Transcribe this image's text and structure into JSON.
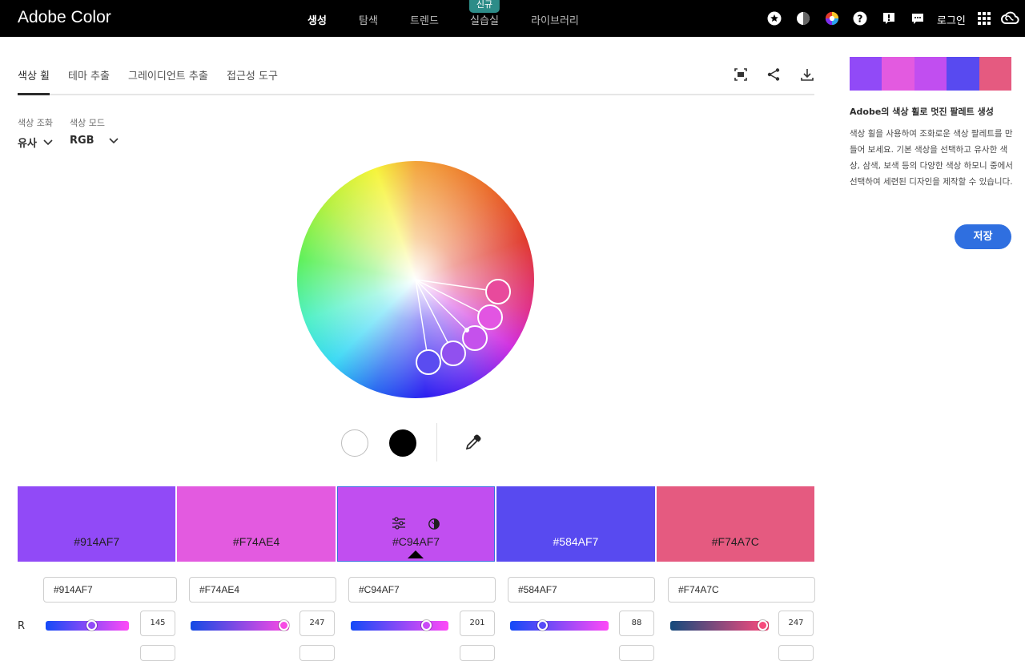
{
  "app": {
    "logo": "Adobe Color",
    "login": "로그인"
  },
  "topnav": {
    "items": [
      {
        "label": "생성",
        "active": true
      },
      {
        "label": "탐색"
      },
      {
        "label": "트렌드"
      },
      {
        "label": "실습실",
        "badge": "신규"
      },
      {
        "label": "라이브러리"
      }
    ],
    "icons": [
      "star-icon",
      "contrast-icon",
      "color-wheel-icon",
      "help-icon",
      "feedback-icon",
      "chat-icon",
      "apps-grid-icon",
      "creative-cloud-icon"
    ]
  },
  "tabs": [
    {
      "label": "색상 휠",
      "active": true
    },
    {
      "label": "테마 추출"
    },
    {
      "label": "그레이디언트 추출"
    },
    {
      "label": "접근성 도구"
    }
  ],
  "controls": {
    "harmony_label": "색상 조화",
    "harmony_value": "유사",
    "mode_label": "색상 모드",
    "mode_value": "RGB"
  },
  "palette": [
    {
      "hex": "#914AF7",
      "color": "#914AF7",
      "text_color": "#1f1f1f",
      "r": 145
    },
    {
      "hex": "#F74AE4",
      "color": "#E35AE0",
      "text_color": "#1f1f1f",
      "r": 247
    },
    {
      "hex": "#C94AF7",
      "color": "#C14EF0",
      "text_color": "#1f1f1f",
      "r": 201,
      "selected": true
    },
    {
      "hex": "#584AF7",
      "color": "#584AF0",
      "text_color": "#ffffff",
      "r": 88
    },
    {
      "hex": "#F74A7C",
      "color": "#E55A80",
      "text_color": "#1f1f1f",
      "r": 247
    }
  ],
  "slider_label": "R",
  "sidebar": {
    "title": "Adobe의 색상 휠로 멋진 팔레트 생성",
    "body": "색상 휠을 사용하여 조화로운 색상 팔레트를 만들어 보세요. 기본 색상을 선택하고 유사한 색상, 삼색, 보색 등의 다양한 색상 하모니 중에서 선택하여 세련된 디자인을 제작할 수 있습니다.",
    "save": "저장"
  }
}
